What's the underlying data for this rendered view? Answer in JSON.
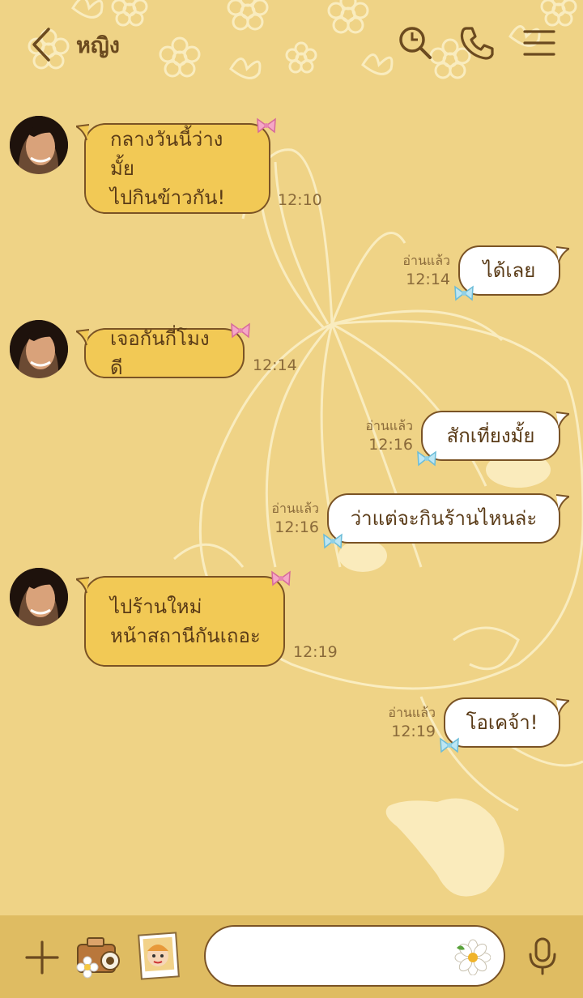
{
  "header": {
    "title": "หญิง",
    "icons": [
      "back-chevron-icon",
      "search-icon",
      "phone-icon",
      "menu-icon"
    ]
  },
  "messages": [
    {
      "side": "in",
      "text": "กลางวันนี้ว่างมั้ย\nไปกินข้าวกัน!",
      "time": "12:10"
    },
    {
      "side": "out",
      "text": "ได้เลย",
      "read": "อ่านแล้ว",
      "time": "12:14"
    },
    {
      "side": "in",
      "text": "เจอกันกี่โมงดี",
      "time": "12:14"
    },
    {
      "side": "out",
      "text": "สักเที่ยงมั้ย",
      "read": "อ่านแล้ว",
      "time": "12:16"
    },
    {
      "side": "out",
      "text": "ว่าแต่จะกินร้านไหนล่ะ",
      "read": "อ่านแล้ว",
      "time": "12:16"
    },
    {
      "side": "in",
      "text": "ไปร้านใหม่\nหน้าสถานีกันเถอะ",
      "time": "12:19"
    },
    {
      "side": "out",
      "text": "โอเคจ้า!",
      "read": "อ่านแล้ว",
      "time": "12:19"
    }
  ],
  "composer": {
    "value": "",
    "icons": [
      "plus-icon",
      "camera-icon",
      "photo-icon",
      "flower-sticker-icon",
      "microphone-icon"
    ]
  },
  "colors": {
    "background": "#efd386",
    "incoming_bubble": "#f2c955",
    "outgoing_bubble": "#ffffff",
    "outline": "#7a5325",
    "bottom_bar": "#dfbc62"
  }
}
